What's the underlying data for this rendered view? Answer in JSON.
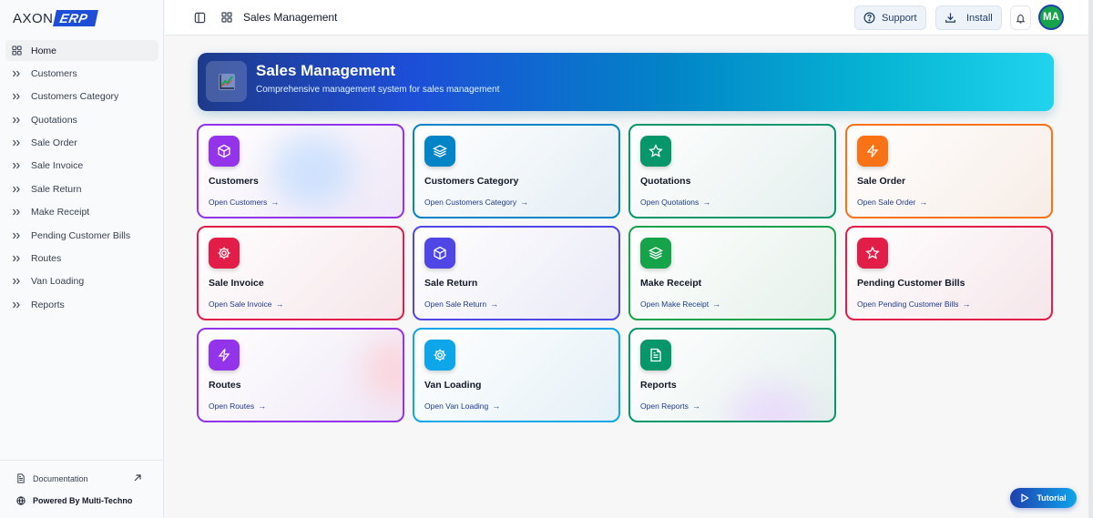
{
  "sidebar": {
    "logo": {
      "part1": "AXON",
      "part2": "ERP"
    },
    "items": [
      {
        "label": "Home",
        "active": true
      },
      {
        "label": "Customers"
      },
      {
        "label": "Customers Category"
      },
      {
        "label": "Quotations"
      },
      {
        "label": "Sale Order"
      },
      {
        "label": "Sale Invoice"
      },
      {
        "label": "Sale Return"
      },
      {
        "label": "Make Receipt"
      },
      {
        "label": "Pending Customer Bills"
      },
      {
        "label": "Routes"
      },
      {
        "label": "Van Loading"
      },
      {
        "label": "Reports"
      }
    ],
    "footer": {
      "documentation": "Documentation",
      "powered_by": "Powered By Multi-Techno"
    }
  },
  "topbar": {
    "title": "Sales Management",
    "support_label": "Support",
    "install_label": "Install",
    "avatar_initials": "MA"
  },
  "banner": {
    "title": "Sales Management",
    "subtitle": "Comprehensive management system for sales management"
  },
  "cards": [
    {
      "title": "Customers",
      "link": "Open Customers",
      "icon": "cube-icon",
      "color": "#9333ea"
    },
    {
      "title": "Customers Category",
      "link": "Open Customers Category",
      "icon": "layers-icon",
      "color": "#0284c7"
    },
    {
      "title": "Quotations",
      "link": "Open Quotations",
      "icon": "star-icon",
      "color": "#059669"
    },
    {
      "title": "Sale Order",
      "link": "Open Sale Order",
      "icon": "bolt-icon",
      "color": "#f97316"
    },
    {
      "title": "Sale Invoice",
      "link": "Open Sale Invoice",
      "icon": "gear-icon",
      "color": "#e11d48"
    },
    {
      "title": "Sale Return",
      "link": "Open Sale Return",
      "icon": "cube-icon",
      "color": "#4f46e5"
    },
    {
      "title": "Make Receipt",
      "link": "Open Make Receipt",
      "icon": "layers-icon",
      "color": "#16a34a"
    },
    {
      "title": "Pending Customer Bills",
      "link": "Open Pending Customer Bills",
      "icon": "star-icon",
      "color": "#e11d48"
    },
    {
      "title": "Routes",
      "link": "Open Routes",
      "icon": "bolt-icon",
      "color": "#9333ea"
    },
    {
      "title": "Van Loading",
      "link": "Open Van Loading",
      "icon": "gear-icon",
      "color": "#0ea5e9"
    },
    {
      "title": "Reports",
      "link": "Open Reports",
      "icon": "document-icon",
      "color": "#059669"
    }
  ],
  "tutorial": {
    "label": "Tutorial"
  }
}
